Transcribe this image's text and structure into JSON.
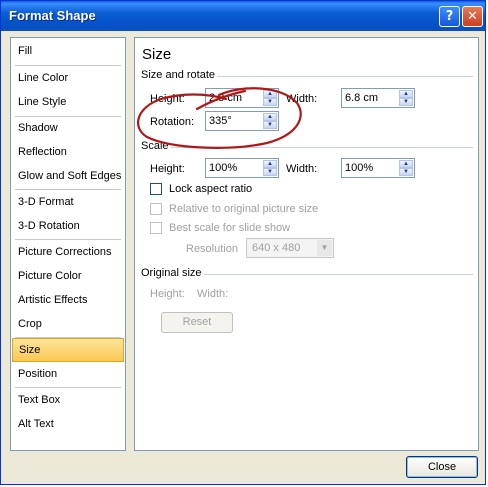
{
  "window": {
    "title": "Format Shape",
    "help_icon": "question-mark",
    "close_icon": "x"
  },
  "nav": {
    "items": [
      {
        "label": "Fill"
      },
      {
        "label": "Line Color"
      },
      {
        "label": "Line Style"
      },
      {
        "label": "Shadow"
      },
      {
        "label": "Reflection"
      },
      {
        "label": "Glow and Soft Edges"
      },
      {
        "label": "3-D Format"
      },
      {
        "label": "3-D Rotation"
      },
      {
        "label": "Picture Corrections"
      },
      {
        "label": "Picture Color"
      },
      {
        "label": "Artistic Effects"
      },
      {
        "label": "Crop"
      },
      {
        "label": "Size",
        "selected": true
      },
      {
        "label": "Position"
      },
      {
        "label": "Text Box"
      },
      {
        "label": "Alt Text"
      }
    ],
    "selected_color": "#fbc854"
  },
  "panel": {
    "heading": "Size",
    "size_rotate": {
      "section": "Size and rotate",
      "height_label": "Height:",
      "height_value": "2.8 cm",
      "width_label": "Width:",
      "width_value": "6.8 cm",
      "rotation_label": "Rotation:",
      "rotation_value": "335°"
    },
    "scale": {
      "section": "Scale",
      "height_label": "Height:",
      "height_value": "100%",
      "width_label": "Width:",
      "width_value": "100%",
      "lock_aspect": "Lock aspect ratio",
      "relative_original": "Relative to original picture size",
      "best_scale": "Best scale for slide show",
      "resolution_label": "Resolution",
      "resolution_value": "640 x 480"
    },
    "original": {
      "section": "Original size",
      "height_label": "Height:",
      "width_label": "Width:",
      "reset_label": "Reset"
    }
  },
  "footer": {
    "close_label": "Close"
  },
  "colors": {
    "title_bar": "#0553c9",
    "annotation": "#b01818"
  }
}
